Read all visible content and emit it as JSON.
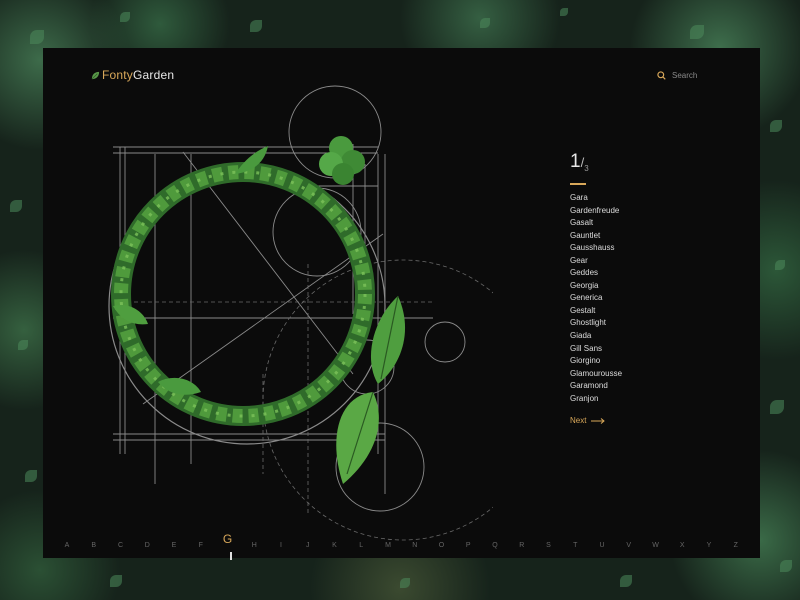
{
  "app": {
    "logo_part1": "Fonty",
    "logo_part2": "Garden",
    "accent_color": "#d9a85a"
  },
  "search": {
    "icon": "search-icon",
    "label": "Search"
  },
  "pager": {
    "current": "1",
    "separator": "/",
    "total": "3"
  },
  "fonts": [
    "Gara",
    "Gardenfreude",
    "Gasalt",
    "Gauntlet",
    "Gausshauss",
    "Gear",
    "Geddes",
    "Georgia",
    "Generica",
    "Gestalt",
    "Ghostlight",
    "Giada",
    "Gill Sans",
    "Giorgino",
    "Glamourousse",
    "Garamond",
    "Granjon"
  ],
  "next": {
    "label": "Next",
    "icon": "arrow-right-icon"
  },
  "alphabet": {
    "letters": [
      "A",
      "B",
      "C",
      "D",
      "E",
      "F",
      "G",
      "H",
      "I",
      "J",
      "K",
      "L",
      "M",
      "N",
      "O",
      "P",
      "Q",
      "R",
      "S",
      "T",
      "U",
      "V",
      "W",
      "X",
      "Y",
      "Z"
    ],
    "active": "G"
  },
  "artwork": {
    "letter": "G",
    "description_icon": "leaf-letter-artwork"
  }
}
